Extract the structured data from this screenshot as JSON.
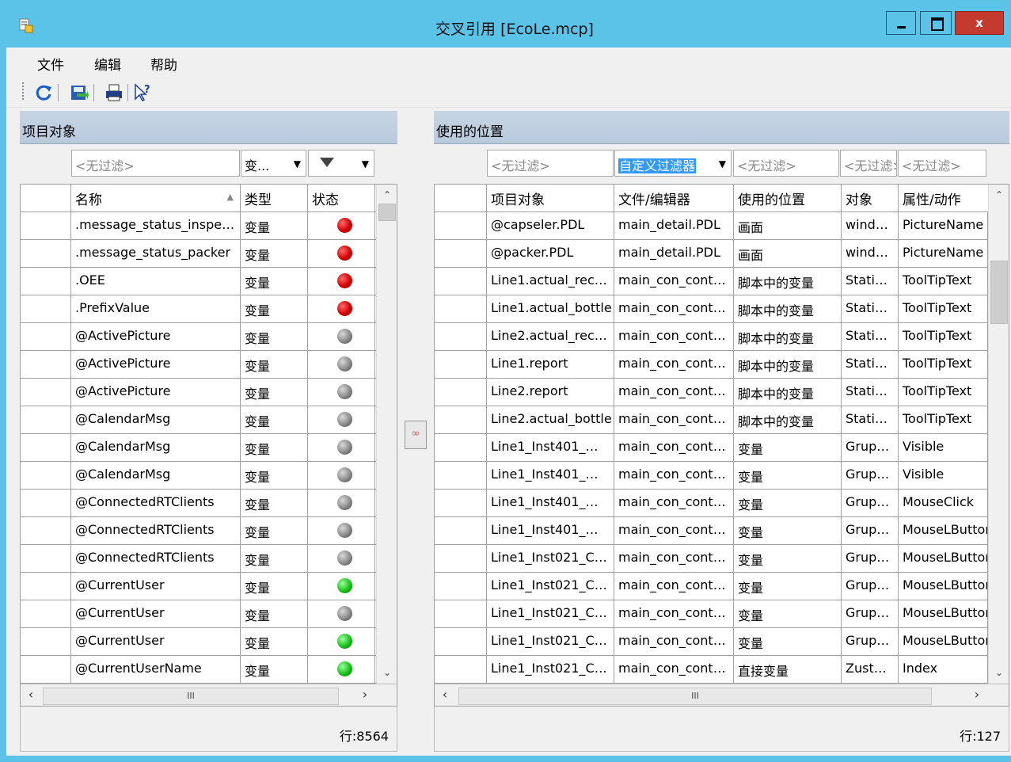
{
  "window": {
    "title": "交叉引用 [EcoLe.mcp]",
    "close_label": "x"
  },
  "menu": {
    "items": [
      "文件",
      "编辑",
      "帮助"
    ]
  },
  "toolbar": {
    "icons": [
      "refresh-icon",
      "export-icon",
      "print-icon",
      "help-pointer-icon"
    ]
  },
  "left_panel": {
    "title": "项目对象",
    "filters": {
      "name": "<无过滤>",
      "type": "变...",
      "status": "▼"
    },
    "columns": [
      "名称",
      "类型",
      "状态"
    ],
    "sort_indicator": "▲",
    "rows": [
      {
        "name": ".message_status_inspe…",
        "type": "变量",
        "status": "red"
      },
      {
        "name": ".message_status_packer",
        "type": "变量",
        "status": "red"
      },
      {
        "name": ".OEE",
        "type": "变量",
        "status": "red"
      },
      {
        "name": ".PrefixValue",
        "type": "变量",
        "status": "red"
      },
      {
        "name": "@ActivePicture",
        "type": "变量",
        "status": "gray"
      },
      {
        "name": "@ActivePicture",
        "type": "变量",
        "status": "gray"
      },
      {
        "name": "@ActivePicture",
        "type": "变量",
        "status": "gray"
      },
      {
        "name": "@CalendarMsg",
        "type": "变量",
        "status": "gray"
      },
      {
        "name": "@CalendarMsg",
        "type": "变量",
        "status": "gray"
      },
      {
        "name": "@CalendarMsg",
        "type": "变量",
        "status": "gray"
      },
      {
        "name": "@ConnectedRTClients",
        "type": "变量",
        "status": "gray"
      },
      {
        "name": "@ConnectedRTClients",
        "type": "变量",
        "status": "gray"
      },
      {
        "name": "@ConnectedRTClients",
        "type": "变量",
        "status": "gray"
      },
      {
        "name": "@CurrentUser",
        "type": "变量",
        "status": "green"
      },
      {
        "name": "@CurrentUser",
        "type": "变量",
        "status": "gray"
      },
      {
        "name": "@CurrentUser",
        "type": "变量",
        "status": "green"
      },
      {
        "name": "@CurrentUserName",
        "type": "变量",
        "status": "green"
      }
    ],
    "row_count": "行:8564"
  },
  "right_panel": {
    "title": "使用的位置",
    "filters": [
      "<无过滤>",
      "自定义过滤器",
      "<无过滤>",
      "<无过滤>",
      "<无过滤>"
    ],
    "columns": [
      "项目对象",
      "文件/编辑器",
      "使用的位置",
      "对象",
      "属性/动作"
    ],
    "rows": [
      [
        "@capseler.PDL",
        "main_detail.PDL",
        "画面",
        "wind…",
        "PictureName"
      ],
      [
        "@packer.PDL",
        "main_detail.PDL",
        "画面",
        "wind…",
        "PictureName"
      ],
      [
        "Line1.actual_rec…",
        "main_con_cont…",
        "脚本中的变量",
        "Stati…",
        "ToolTipText"
      ],
      [
        "Line1.actual_bottle",
        "main_con_cont…",
        "脚本中的变量",
        "Stati…",
        "ToolTipText"
      ],
      [
        "Line2.actual_rec…",
        "main_con_cont…",
        "脚本中的变量",
        "Stati…",
        "ToolTipText"
      ],
      [
        "Line1.report",
        "main_con_cont…",
        "脚本中的变量",
        "Stati…",
        "ToolTipText"
      ],
      [
        "Line2.report",
        "main_con_cont…",
        "脚本中的变量",
        "Stati…",
        "ToolTipText"
      ],
      [
        "Line2.actual_bottle",
        "main_con_cont…",
        "脚本中的变量",
        "Stati…",
        "ToolTipText"
      ],
      [
        "Line1_Inst401_…",
        "main_con_cont…",
        "变量",
        "Grup…",
        "Visible"
      ],
      [
        "Line1_Inst401_…",
        "main_con_cont…",
        "变量",
        "Grup…",
        "Visible"
      ],
      [
        "Line1_Inst401_…",
        "main_con_cont…",
        "变量",
        "Grup…",
        "MouseClick"
      ],
      [
        "Line1_Inst401_…",
        "main_con_cont…",
        "变量",
        "Grup…",
        "MouseLButtonD"
      ],
      [
        "Line1_Inst021_C…",
        "main_con_cont…",
        "变量",
        "Grup…",
        "MouseLButtonU"
      ],
      [
        "Line1_Inst021_C…",
        "main_con_cont…",
        "变量",
        "Grup…",
        "MouseLButtonD"
      ],
      [
        "Line1_Inst021_C…",
        "main_con_cont…",
        "变量",
        "Grup…",
        "MouseLButtonU"
      ],
      [
        "Line1_Inst021_C…",
        "main_con_cont…",
        "变量",
        "Grup…",
        "MouseLButtonD"
      ],
      [
        "Line1_Inst021_C…",
        "main_con_cont…",
        "直接变量",
        "Zust…",
        "Index"
      ]
    ],
    "row_count": "行:127"
  },
  "scrollbar_grip": "III"
}
